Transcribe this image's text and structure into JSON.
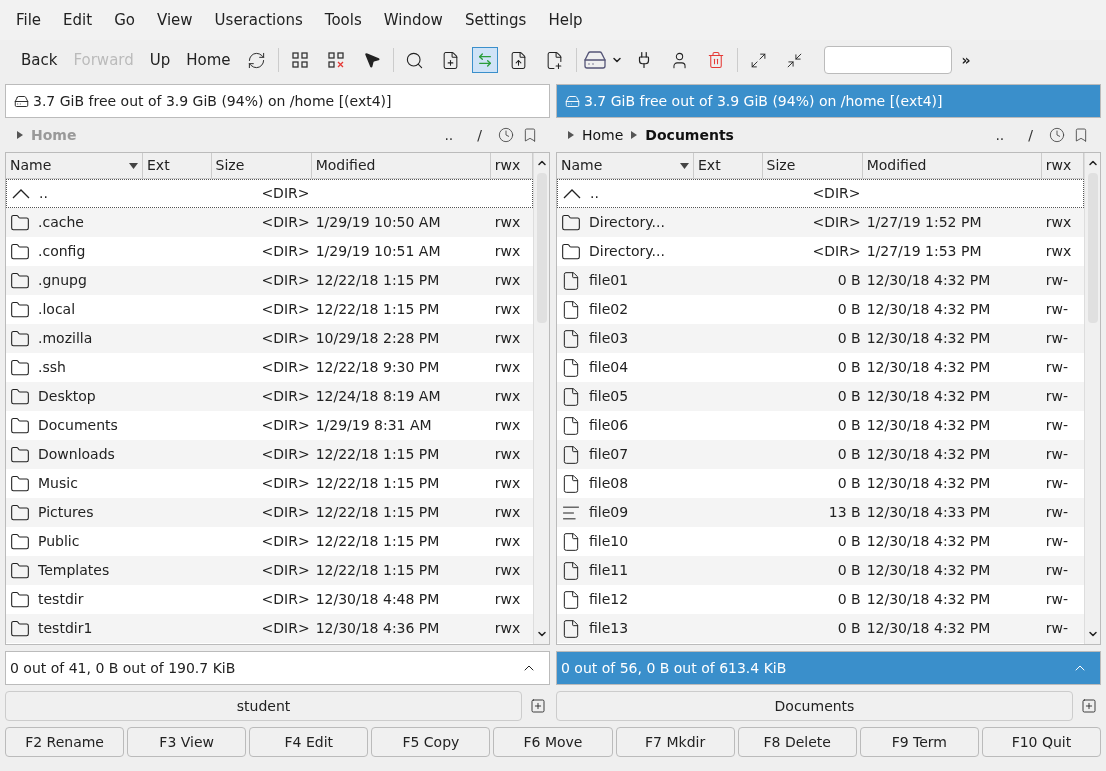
{
  "menu": [
    "File",
    "Edit",
    "Go",
    "View",
    "Useractions",
    "Tools",
    "Window",
    "Settings",
    "Help"
  ],
  "toolbar": {
    "nav_buttons": [
      {
        "label": "Back",
        "disabled": false
      },
      {
        "label": "Forward",
        "disabled": true
      },
      {
        "label": "Up",
        "disabled": false
      },
      {
        "label": "Home",
        "disabled": false
      }
    ],
    "overflow": "»"
  },
  "panels": [
    {
      "active": false,
      "disk_info": "3.7 GiB free out of 3.9 GiB (94%) on /home [(ext4)]",
      "breadcrumb": [
        {
          "label": "Home",
          "current": true
        }
      ],
      "path_buttons": [
        "..",
        "/"
      ],
      "columns": [
        "Name",
        "Ext",
        "Size",
        "Modified",
        "rwx"
      ],
      "rows": [
        {
          "kind": "parent",
          "name": "..",
          "size": "<DIR>"
        },
        {
          "kind": "folder",
          "name": ".cache",
          "size": "<DIR>",
          "modified": "1/29/19 10:50 AM",
          "rwx": "rwx"
        },
        {
          "kind": "folder",
          "name": ".config",
          "size": "<DIR>",
          "modified": "1/29/19 10:51 AM",
          "rwx": "rwx"
        },
        {
          "kind": "folder",
          "name": ".gnupg",
          "size": "<DIR>",
          "modified": "12/22/18 1:15 PM",
          "rwx": "rwx"
        },
        {
          "kind": "folder",
          "name": ".local",
          "size": "<DIR>",
          "modified": "12/22/18 1:15 PM",
          "rwx": "rwx"
        },
        {
          "kind": "folder",
          "name": ".mozilla",
          "size": "<DIR>",
          "modified": "10/29/18 2:28 PM",
          "rwx": "rwx"
        },
        {
          "kind": "folder",
          "name": ".ssh",
          "size": "<DIR>",
          "modified": "12/22/18 9:30 PM",
          "rwx": "rwx"
        },
        {
          "kind": "folder",
          "name": "Desktop",
          "size": "<DIR>",
          "modified": "12/24/18 8:19 AM",
          "rwx": "rwx"
        },
        {
          "kind": "folder",
          "name": "Documents",
          "size": "<DIR>",
          "modified": "1/29/19 8:31 AM",
          "rwx": "rwx"
        },
        {
          "kind": "folder",
          "name": "Downloads",
          "size": "<DIR>",
          "modified": "12/22/18 1:15 PM",
          "rwx": "rwx"
        },
        {
          "kind": "folder",
          "name": "Music",
          "size": "<DIR>",
          "modified": "12/22/18 1:15 PM",
          "rwx": "rwx"
        },
        {
          "kind": "folder",
          "name": "Pictures",
          "size": "<DIR>",
          "modified": "12/22/18 1:15 PM",
          "rwx": "rwx"
        },
        {
          "kind": "folder",
          "name": "Public",
          "size": "<DIR>",
          "modified": "12/22/18 1:15 PM",
          "rwx": "rwx"
        },
        {
          "kind": "folder",
          "name": "Templates",
          "size": "<DIR>",
          "modified": "12/22/18 1:15 PM",
          "rwx": "rwx"
        },
        {
          "kind": "folder",
          "name": "testdir",
          "size": "<DIR>",
          "modified": "12/30/18 4:48 PM",
          "rwx": "rwx"
        },
        {
          "kind": "folder",
          "name": "testdir1",
          "size": "<DIR>",
          "modified": "12/30/18 4:36 PM",
          "rwx": "rwx"
        }
      ],
      "status": "0 out of 41, 0 B out of 190.7 KiB",
      "command": "student"
    },
    {
      "active": true,
      "disk_info": "3.7 GiB free out of 3.9 GiB (94%) on /home [(ext4)]",
      "breadcrumb": [
        {
          "label": "Home",
          "current": false
        },
        {
          "label": "Documents",
          "current": true
        }
      ],
      "path_buttons": [
        "..",
        "/"
      ],
      "columns": [
        "Name",
        "Ext",
        "Size",
        "Modified",
        "rwx"
      ],
      "rows": [
        {
          "kind": "parent",
          "name": "..",
          "size": "<DIR>"
        },
        {
          "kind": "folder",
          "name": "Directory...",
          "size": "<DIR>",
          "modified": "1/27/19 1:52 PM",
          "rwx": "rwx"
        },
        {
          "kind": "folder",
          "name": "Directory...",
          "size": "<DIR>",
          "modified": "1/27/19 1:53 PM",
          "rwx": "rwx"
        },
        {
          "kind": "file",
          "name": "file01",
          "size": "0 B",
          "modified": "12/30/18 4:32 PM",
          "rwx": "rw-"
        },
        {
          "kind": "file",
          "name": "file02",
          "size": "0 B",
          "modified": "12/30/18 4:32 PM",
          "rwx": "rw-"
        },
        {
          "kind": "file",
          "name": "file03",
          "size": "0 B",
          "modified": "12/30/18 4:32 PM",
          "rwx": "rw-"
        },
        {
          "kind": "file",
          "name": "file04",
          "size": "0 B",
          "modified": "12/30/18 4:32 PM",
          "rwx": "rw-"
        },
        {
          "kind": "file",
          "name": "file05",
          "size": "0 B",
          "modified": "12/30/18 4:32 PM",
          "rwx": "rw-"
        },
        {
          "kind": "file",
          "name": "file06",
          "size": "0 B",
          "modified": "12/30/18 4:32 PM",
          "rwx": "rw-"
        },
        {
          "kind": "file",
          "name": "file07",
          "size": "0 B",
          "modified": "12/30/18 4:32 PM",
          "rwx": "rw-"
        },
        {
          "kind": "file",
          "name": "file08",
          "size": "0 B",
          "modified": "12/30/18 4:32 PM",
          "rwx": "rw-"
        },
        {
          "kind": "text",
          "name": "file09",
          "size": "13 B",
          "modified": "12/30/18 4:33 PM",
          "rwx": "rw-"
        },
        {
          "kind": "file",
          "name": "file10",
          "size": "0 B",
          "modified": "12/30/18 4:32 PM",
          "rwx": "rw-"
        },
        {
          "kind": "file",
          "name": "file11",
          "size": "0 B",
          "modified": "12/30/18 4:32 PM",
          "rwx": "rw-"
        },
        {
          "kind": "file",
          "name": "file12",
          "size": "0 B",
          "modified": "12/30/18 4:32 PM",
          "rwx": "rw-"
        },
        {
          "kind": "file",
          "name": "file13",
          "size": "0 B",
          "modified": "12/30/18 4:32 PM",
          "rwx": "rw-"
        }
      ],
      "status": "0 out of 56, 0 B out of 613.4 KiB",
      "command": "Documents"
    }
  ],
  "function_keys": [
    "F2 Rename",
    "F3 View",
    "F4 Edit",
    "F5 Copy",
    "F6 Move",
    "F7 Mkdir",
    "F8 Delete",
    "F9 Term",
    "F10 Quit"
  ]
}
